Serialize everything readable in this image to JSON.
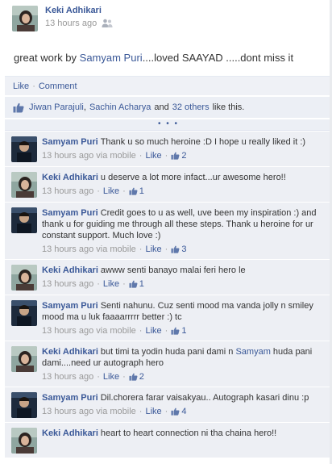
{
  "post": {
    "author": "Keki Adhikari",
    "timestamp": "13 hours ago",
    "audience_icon": "friends-icon",
    "text_prefix": "great work by ",
    "text_mention": "Samyam Puri",
    "text_suffix": "....loved SAAYAD .....dont miss it"
  },
  "actions": {
    "like": "Like",
    "separator": "·",
    "comment": "Comment"
  },
  "likes": {
    "person1": "Jiwan Parajuli",
    "person2": "Sachin Acharya",
    "and": "and",
    "others": "32 others",
    "suffix": "like this."
  },
  "more_comments": "• • •",
  "comments": [
    {
      "author": "Samyam Puri",
      "text": "Thank u so much heroine :D I hope u really liked it :)",
      "time": "13 hours ago via mobile",
      "like": "Like",
      "likes": "2"
    },
    {
      "author": "Keki Adhikari",
      "text": "u deserve a lot more infact...ur awesome hero!!",
      "time": "13 hours ago",
      "like": "Like",
      "likes": "1"
    },
    {
      "author": "Samyam Puri",
      "text": "Credit goes to u as well, uve been my inspiration :) and thank u for guiding me through all these steps. Thank u heroine for ur constant support. Much love :)",
      "time": "13 hours ago via mobile",
      "like": "Like",
      "likes": "3"
    },
    {
      "author": "Keki Adhikari",
      "text": "awww senti banayo malai feri hero le",
      "time": "13 hours ago",
      "like": "Like",
      "likes": "1"
    },
    {
      "author": "Samyam Puri",
      "text": "Senti nahunu. Cuz senti mood ma vanda jolly n smiley mood ma u luk faaaarrrrr better :) tc",
      "time": "13 hours ago via mobile",
      "like": "Like",
      "likes": "1"
    },
    {
      "author": "Keki Adhikari",
      "text_prefix": "but timi ta yodin huda pani dami n ",
      "text_mention": "Samyam",
      "text_suffix": " huda pani dami....need ur autograph hero",
      "time": "13 hours ago",
      "like": "Like",
      "likes": "2"
    },
    {
      "author": "Samyam Puri",
      "text": "Dil.chorera farar vaisakyau.. Autograph kasari dinu :p",
      "time": "13 hours ago via mobile",
      "like": "Like",
      "likes": "4"
    },
    {
      "author": "Keki Adhikari",
      "text": "heart to heart connection ni tha chaina hero!!"
    }
  ],
  "colors": {
    "link": "#3b5998",
    "comment_bg": "#edeff4",
    "meta_gray": "#999999"
  }
}
